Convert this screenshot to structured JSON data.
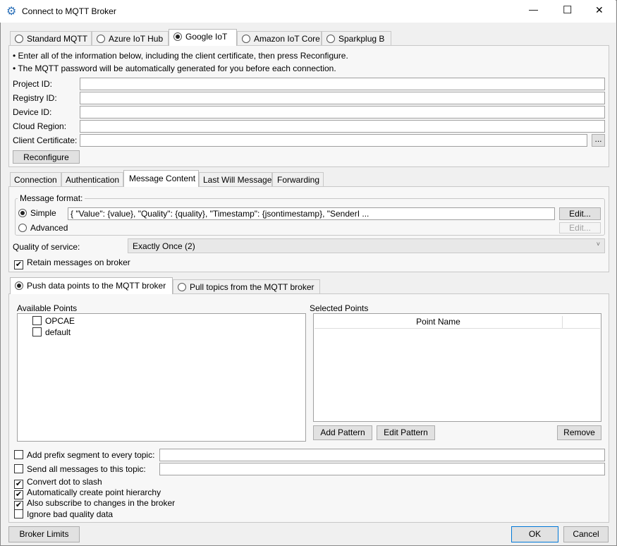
{
  "window": {
    "title": "Connect to MQTT Broker",
    "minimize": "—",
    "maximize": "☐",
    "close": "✕"
  },
  "broker_tabs": [
    {
      "label": "Standard MQTT",
      "selected": false
    },
    {
      "label": "Azure IoT Hub",
      "selected": false
    },
    {
      "label": "Google IoT",
      "selected": true
    },
    {
      "label": "Amazon IoT Core",
      "selected": false
    },
    {
      "label": "Sparkplug B",
      "selected": false
    }
  ],
  "google": {
    "notes": [
      "Enter all of the information below, including the client certificate, then press Reconfigure.",
      "The MQTT password will be automatically generated for you before each connection."
    ],
    "fields": [
      {
        "label": "Project ID:",
        "value": ""
      },
      {
        "label": "Registry ID:",
        "value": ""
      },
      {
        "label": "Device ID:",
        "value": ""
      },
      {
        "label": "Cloud Region:",
        "value": ""
      },
      {
        "label": "Client Certificate:",
        "value": ""
      }
    ],
    "browse": "...",
    "reconfigure": "Reconfigure"
  },
  "settings_tabs": [
    {
      "label": "Connection"
    },
    {
      "label": "Authentication"
    },
    {
      "label": "Message Content"
    },
    {
      "label": "Last Will Message"
    },
    {
      "label": "Forwarding"
    }
  ],
  "message": {
    "group": "Message format:",
    "simple": "Simple",
    "advanced": "Advanced",
    "simple_value": "{ \"Value\": {value}, \"Quality\": {quality}, \"Timestamp\": {jsontimestamp}, \"SenderI ...",
    "edit": "Edit...",
    "qos_label": "Quality of service:",
    "qos_value": "Exactly Once (2)",
    "retain": "Retain messages on broker"
  },
  "direction_tabs": [
    {
      "label": "Push data points to the MQTT broker",
      "selected": true
    },
    {
      "label": "Pull topics from the MQTT broker",
      "selected": false
    }
  ],
  "points": {
    "available_label": "Available Points",
    "available": [
      {
        "label": "OPCAE",
        "checked": false
      },
      {
        "label": "default",
        "checked": false
      }
    ],
    "selected_label": "Selected Points",
    "column": "Point Name",
    "add_pattern": "Add Pattern",
    "edit_pattern": "Edit Pattern",
    "remove": "Remove"
  },
  "options": {
    "prefix": "Add prefix segment to every topic:",
    "prefix_value": "",
    "send_all": "Send all messages to this topic:",
    "send_all_value": "",
    "checks": [
      {
        "label": "Convert dot to slash",
        "checked": true
      },
      {
        "label": "Automatically create point hierarchy",
        "checked": true
      },
      {
        "label": "Also subscribe to changes in the broker",
        "checked": true
      },
      {
        "label": "Ignore bad quality data",
        "checked": false
      }
    ]
  },
  "footer": {
    "broker_limits": "Broker Limits",
    "ok": "OK",
    "cancel": "Cancel"
  }
}
